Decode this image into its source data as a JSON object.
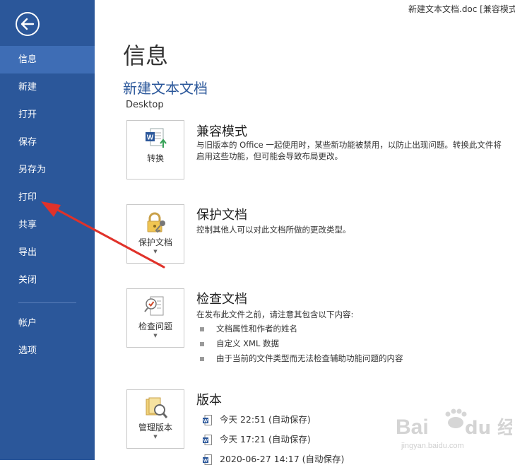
{
  "window": {
    "title": "新建文本文档.doc [兼容模式"
  },
  "sidebar": {
    "items": [
      {
        "label": "信息"
      },
      {
        "label": "新建"
      },
      {
        "label": "打开"
      },
      {
        "label": "保存"
      },
      {
        "label": "另存为"
      },
      {
        "label": "打印"
      },
      {
        "label": "共享"
      },
      {
        "label": "导出"
      },
      {
        "label": "关闭"
      },
      {
        "label": "帐户"
      },
      {
        "label": "选项"
      }
    ],
    "active": "信息",
    "accent": "#2b579a"
  },
  "main": {
    "page_title": "信息",
    "doc_name": "新建文本文档",
    "doc_path": "Desktop",
    "compat": {
      "tile_label": "转换",
      "title": "兼容模式",
      "desc_lines": [
        "与旧版本的 Office 一起使用时，某些新功能被禁用，以防止出现问题。转换此文件将",
        "启用这些功能，但可能会导致布局更改。"
      ]
    },
    "protect": {
      "tile_label": "保护文档",
      "title": "保护文档",
      "desc": "控制其他人可以对此文档所做的更改类型。"
    },
    "inspect": {
      "tile_label": "检查问题",
      "title": "检查文档",
      "desc": "在发布此文件之前，请注意其包含以下内容:",
      "bullets": [
        "文档属性和作者的姓名",
        "自定义 XML 数据",
        "由于当前的文件类型而无法检查辅助功能问题的内容"
      ]
    },
    "versions": {
      "tile_label": "管理版本",
      "title": "版本",
      "items": [
        "今天 22:51 (自动保存)",
        "今天 17:21 (自动保存)",
        "2020-06-27 14:17 (自动保存)"
      ]
    }
  },
  "icons": {
    "back": "back-arrow-icon",
    "convert": "word-convert-icon",
    "protect": "lock-key-icon",
    "inspect": "checklist-icon",
    "versions": "manage-versions-icon"
  },
  "watermark": {
    "text": "Bai du 经验",
    "sub": "jingyan.baidu.com"
  }
}
